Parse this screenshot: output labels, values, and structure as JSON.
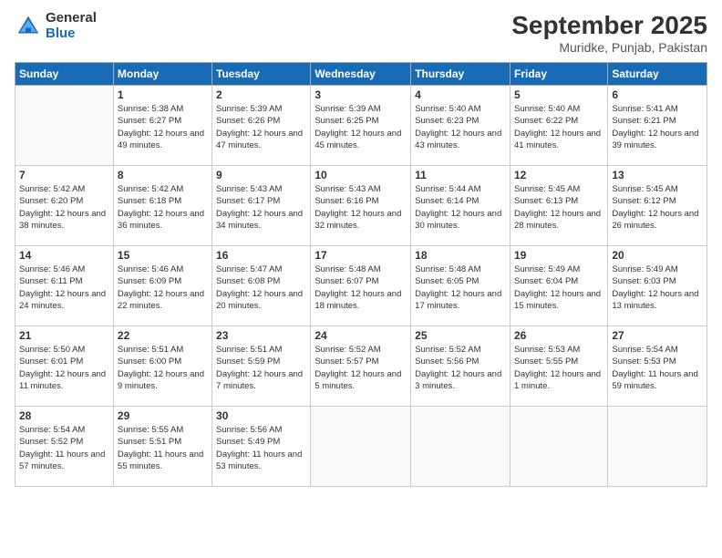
{
  "logo": {
    "general": "General",
    "blue": "Blue"
  },
  "title": "September 2025",
  "location": "Muridke, Punjab, Pakistan",
  "weekdays": [
    "Sunday",
    "Monday",
    "Tuesday",
    "Wednesday",
    "Thursday",
    "Friday",
    "Saturday"
  ],
  "weeks": [
    [
      {
        "date": "",
        "sunrise": "",
        "sunset": "",
        "daylight": ""
      },
      {
        "date": "1",
        "sunrise": "Sunrise: 5:38 AM",
        "sunset": "Sunset: 6:27 PM",
        "daylight": "Daylight: 12 hours and 49 minutes."
      },
      {
        "date": "2",
        "sunrise": "Sunrise: 5:39 AM",
        "sunset": "Sunset: 6:26 PM",
        "daylight": "Daylight: 12 hours and 47 minutes."
      },
      {
        "date": "3",
        "sunrise": "Sunrise: 5:39 AM",
        "sunset": "Sunset: 6:25 PM",
        "daylight": "Daylight: 12 hours and 45 minutes."
      },
      {
        "date": "4",
        "sunrise": "Sunrise: 5:40 AM",
        "sunset": "Sunset: 6:23 PM",
        "daylight": "Daylight: 12 hours and 43 minutes."
      },
      {
        "date": "5",
        "sunrise": "Sunrise: 5:40 AM",
        "sunset": "Sunset: 6:22 PM",
        "daylight": "Daylight: 12 hours and 41 minutes."
      },
      {
        "date": "6",
        "sunrise": "Sunrise: 5:41 AM",
        "sunset": "Sunset: 6:21 PM",
        "daylight": "Daylight: 12 hours and 39 minutes."
      }
    ],
    [
      {
        "date": "7",
        "sunrise": "Sunrise: 5:42 AM",
        "sunset": "Sunset: 6:20 PM",
        "daylight": "Daylight: 12 hours and 38 minutes."
      },
      {
        "date": "8",
        "sunrise": "Sunrise: 5:42 AM",
        "sunset": "Sunset: 6:18 PM",
        "daylight": "Daylight: 12 hours and 36 minutes."
      },
      {
        "date": "9",
        "sunrise": "Sunrise: 5:43 AM",
        "sunset": "Sunset: 6:17 PM",
        "daylight": "Daylight: 12 hours and 34 minutes."
      },
      {
        "date": "10",
        "sunrise": "Sunrise: 5:43 AM",
        "sunset": "Sunset: 6:16 PM",
        "daylight": "Daylight: 12 hours and 32 minutes."
      },
      {
        "date": "11",
        "sunrise": "Sunrise: 5:44 AM",
        "sunset": "Sunset: 6:14 PM",
        "daylight": "Daylight: 12 hours and 30 minutes."
      },
      {
        "date": "12",
        "sunrise": "Sunrise: 5:45 AM",
        "sunset": "Sunset: 6:13 PM",
        "daylight": "Daylight: 12 hours and 28 minutes."
      },
      {
        "date": "13",
        "sunrise": "Sunrise: 5:45 AM",
        "sunset": "Sunset: 6:12 PM",
        "daylight": "Daylight: 12 hours and 26 minutes."
      }
    ],
    [
      {
        "date": "14",
        "sunrise": "Sunrise: 5:46 AM",
        "sunset": "Sunset: 6:11 PM",
        "daylight": "Daylight: 12 hours and 24 minutes."
      },
      {
        "date": "15",
        "sunrise": "Sunrise: 5:46 AM",
        "sunset": "Sunset: 6:09 PM",
        "daylight": "Daylight: 12 hours and 22 minutes."
      },
      {
        "date": "16",
        "sunrise": "Sunrise: 5:47 AM",
        "sunset": "Sunset: 6:08 PM",
        "daylight": "Daylight: 12 hours and 20 minutes."
      },
      {
        "date": "17",
        "sunrise": "Sunrise: 5:48 AM",
        "sunset": "Sunset: 6:07 PM",
        "daylight": "Daylight: 12 hours and 18 minutes."
      },
      {
        "date": "18",
        "sunrise": "Sunrise: 5:48 AM",
        "sunset": "Sunset: 6:05 PM",
        "daylight": "Daylight: 12 hours and 17 minutes."
      },
      {
        "date": "19",
        "sunrise": "Sunrise: 5:49 AM",
        "sunset": "Sunset: 6:04 PM",
        "daylight": "Daylight: 12 hours and 15 minutes."
      },
      {
        "date": "20",
        "sunrise": "Sunrise: 5:49 AM",
        "sunset": "Sunset: 6:03 PM",
        "daylight": "Daylight: 12 hours and 13 minutes."
      }
    ],
    [
      {
        "date": "21",
        "sunrise": "Sunrise: 5:50 AM",
        "sunset": "Sunset: 6:01 PM",
        "daylight": "Daylight: 12 hours and 11 minutes."
      },
      {
        "date": "22",
        "sunrise": "Sunrise: 5:51 AM",
        "sunset": "Sunset: 6:00 PM",
        "daylight": "Daylight: 12 hours and 9 minutes."
      },
      {
        "date": "23",
        "sunrise": "Sunrise: 5:51 AM",
        "sunset": "Sunset: 5:59 PM",
        "daylight": "Daylight: 12 hours and 7 minutes."
      },
      {
        "date": "24",
        "sunrise": "Sunrise: 5:52 AM",
        "sunset": "Sunset: 5:57 PM",
        "daylight": "Daylight: 12 hours and 5 minutes."
      },
      {
        "date": "25",
        "sunrise": "Sunrise: 5:52 AM",
        "sunset": "Sunset: 5:56 PM",
        "daylight": "Daylight: 12 hours and 3 minutes."
      },
      {
        "date": "26",
        "sunrise": "Sunrise: 5:53 AM",
        "sunset": "Sunset: 5:55 PM",
        "daylight": "Daylight: 12 hours and 1 minute."
      },
      {
        "date": "27",
        "sunrise": "Sunrise: 5:54 AM",
        "sunset": "Sunset: 5:53 PM",
        "daylight": "Daylight: 11 hours and 59 minutes."
      }
    ],
    [
      {
        "date": "28",
        "sunrise": "Sunrise: 5:54 AM",
        "sunset": "Sunset: 5:52 PM",
        "daylight": "Daylight: 11 hours and 57 minutes."
      },
      {
        "date": "29",
        "sunrise": "Sunrise: 5:55 AM",
        "sunset": "Sunset: 5:51 PM",
        "daylight": "Daylight: 11 hours and 55 minutes."
      },
      {
        "date": "30",
        "sunrise": "Sunrise: 5:56 AM",
        "sunset": "Sunset: 5:49 PM",
        "daylight": "Daylight: 11 hours and 53 minutes."
      },
      {
        "date": "",
        "sunrise": "",
        "sunset": "",
        "daylight": ""
      },
      {
        "date": "",
        "sunrise": "",
        "sunset": "",
        "daylight": ""
      },
      {
        "date": "",
        "sunrise": "",
        "sunset": "",
        "daylight": ""
      },
      {
        "date": "",
        "sunrise": "",
        "sunset": "",
        "daylight": ""
      }
    ]
  ]
}
